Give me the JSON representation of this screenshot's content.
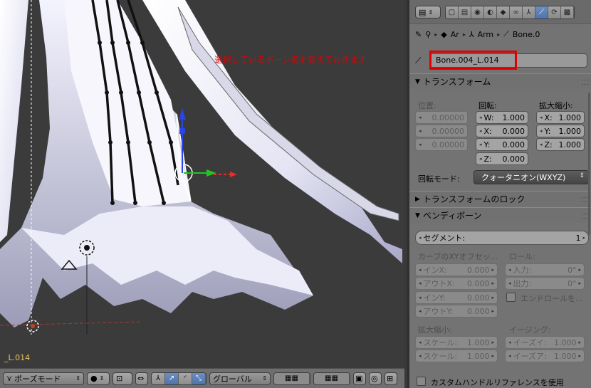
{
  "viewport": {
    "annotation": "選択しているボーン名を覚えておきます",
    "active_bone_overlay": "_L.014"
  },
  "header": {
    "mode": "ポーズモード",
    "orientation": "グローバル",
    "icons": [
      "mode-icon",
      "shading-icon",
      "pivot-icon",
      "manipulator-icon",
      "translate-icon",
      "rotate-icon",
      "scale-icon",
      "orientation-icon",
      "layers-icon",
      "lock-icon",
      "render-icon"
    ]
  },
  "properties": {
    "tabs": [
      "render-icon",
      "render-layers-icon",
      "scene-icon",
      "world-icon",
      "object-icon",
      "constraints-icon",
      "data-icon",
      "bone-icon",
      "bone-constraint-icon",
      "texture-icon"
    ],
    "breadcrumb": [
      "Ar",
      "Arm",
      "Bone.0"
    ],
    "bone_name": "Bone.004_L.014",
    "transform": {
      "title": "トランスフォーム",
      "position_label": "位置:",
      "rotation_label": "回転:",
      "scale_label": "拡大縮小:",
      "position": [
        "0.00000",
        "0.00000",
        "0.00000"
      ],
      "rotation": [
        {
          "axis": "W:",
          "value": "1.000"
        },
        {
          "axis": "X:",
          "value": "0.000"
        },
        {
          "axis": "Y:",
          "value": "0.000"
        },
        {
          "axis": "Z:",
          "value": "0.000"
        }
      ],
      "scale": [
        {
          "axis": "X:",
          "value": "1.000"
        },
        {
          "axis": "Y:",
          "value": "1.000"
        },
        {
          "axis": "Z:",
          "value": "1.000"
        }
      ],
      "rotation_mode_label": "回転モード:",
      "rotation_mode": "クォータニオン(WXYZ)"
    },
    "transform_lock": {
      "title": "トランスフォームのロック"
    },
    "bendy": {
      "title": "ベンディボーン",
      "segments_label": "セグメント:",
      "segments": "1",
      "curve_offset_label": "カーブのXYオフセッ...",
      "roll_label": "ロール:",
      "in_x_label": "インX:",
      "in_x": "0.000",
      "out_x_label": "アウトX:",
      "out_x": "0.000",
      "in_y_label": "インY:",
      "in_y": "0.000",
      "out_y_label": "アウトY:",
      "out_y": "0.000",
      "roll_in_label": "入力:",
      "roll_in": "0°",
      "roll_out_label": "出力:",
      "roll_out": "0°",
      "end_roll_label": "エンドロールを...",
      "scale_label": "拡大縮小:",
      "scale_in_label": "スケール:",
      "scale_in": "1.000",
      "scale_out_label": "スケール:",
      "scale_out": "1.000",
      "easing_label": "イージング:",
      "ease_in_label": "イーズイ:",
      "ease_in": "1.000",
      "ease_out_label": "イーズア:",
      "ease_out": "1.000"
    },
    "custom_handle_label": "カスタムハンドルリファレンスを使用"
  }
}
